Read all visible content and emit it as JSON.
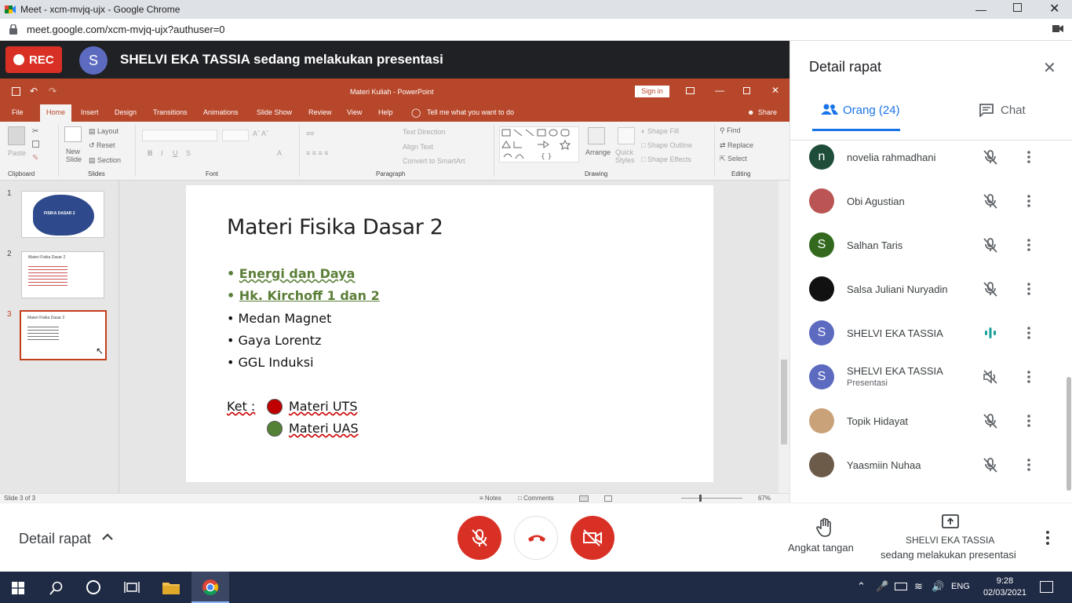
{
  "browser": {
    "window_title": "Meet - xcm-mvjq-ujx - Google Chrome",
    "url": "meet.google.com/xcm-mvjq-ujx?authuser=0"
  },
  "meet_banner": {
    "rec_label": "REC",
    "presenter_initial": "S",
    "presenter_text": "SHELVI EKA TASSIA sedang melakukan presentasi"
  },
  "powerpoint": {
    "doc_title": "Materi Kuliah - PowerPoint",
    "sign_in": "Sign in",
    "tabs": [
      "File",
      "Home",
      "Insert",
      "Design",
      "Transitions",
      "Animations",
      "Slide Show",
      "Review",
      "View",
      "Help"
    ],
    "tell_me": "Tell me what you want to do",
    "share": "Share",
    "ribbon": {
      "paste": "Paste",
      "new_slide": "New Slide",
      "layout": "Layout",
      "reset": "Reset",
      "section": "Section",
      "text_direction": "Text Direction",
      "align_text": "Align Text",
      "convert_smartart": "Convert to SmartArt",
      "arrange": "Arrange",
      "quick_styles": "Quick Styles",
      "shape_fill": "Shape Fill",
      "shape_outline": "Shape Outline",
      "shape_effects": "Shape Effects",
      "find": "Find",
      "replace": "Replace",
      "select": "Select",
      "groups": [
        "Clipboard",
        "Slides",
        "Font",
        "Paragraph",
        "Drawing",
        "Editing"
      ]
    },
    "thumbnails": [
      {
        "num": "1",
        "title": "FISIKA DASAR 2"
      },
      {
        "num": "2",
        "title": "Materi Fisika Dasar 2"
      },
      {
        "num": "3",
        "title": "Materi Fisika Dasar 2"
      }
    ],
    "slide": {
      "title": "Materi Fisika Dasar 2",
      "bullets": [
        "Energi dan Daya",
        "Hk. Kirchoff 1 dan 2",
        "Medan Magnet",
        "Gaya Lorentz",
        "GGL Induksi"
      ],
      "ket_label": "Ket :",
      "legend": [
        {
          "label": "Materi UTS",
          "color": "#c00000"
        },
        {
          "label": "Materi UAS",
          "color": "#538135"
        }
      ]
    },
    "status": {
      "slide_of": "Slide 3 of 3",
      "notes": "Notes",
      "comments": "Comments",
      "zoom": "67%"
    }
  },
  "panel": {
    "title": "Detail rapat",
    "tab_people": "Orang (24)",
    "tab_chat": "Chat",
    "people": [
      {
        "initial": "n",
        "name": "novelia rahmadhani",
        "color": "#1e4d3a",
        "mic": "muted"
      },
      {
        "initial": "",
        "name": "Obi Agustian",
        "color": "#b55",
        "mic": "muted"
      },
      {
        "initial": "S",
        "name": "Salhan Taris",
        "color": "#33691e",
        "mic": "muted"
      },
      {
        "initial": "",
        "name": "Salsa Juliani Nuryadin",
        "color": "#111111",
        "mic": "muted"
      },
      {
        "initial": "S",
        "name": "SHELVI EKA TASSIA",
        "color": "#5c6bc0",
        "mic": "speaking"
      },
      {
        "initial": "S",
        "name": "SHELVI EKA TASSIA",
        "sub": "Presentasi",
        "color": "#5c6bc0",
        "mic": "speaker-muted"
      },
      {
        "initial": "",
        "name": "Topik Hidayat",
        "color": "#c9a27a",
        "mic": "muted"
      },
      {
        "initial": "",
        "name": "Yaasmiin Nuhaa",
        "color": "#6d5b4a",
        "mic": "muted"
      }
    ]
  },
  "bottom": {
    "detail_label": "Detail rapat",
    "raise_hand": "Angkat tangan",
    "presenting_name": "SHELVI EKA TASSIA",
    "presenting_sub": "sedang melakukan presentasi"
  },
  "taskbar": {
    "lang": "ENG",
    "time": "9:28",
    "date": "02/03/2021"
  }
}
